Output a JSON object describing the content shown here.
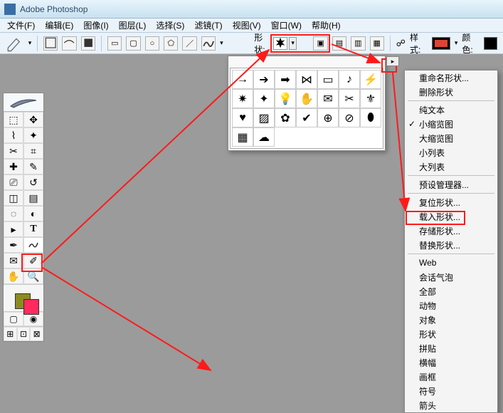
{
  "title": "Adobe Photoshop",
  "menu": [
    "文件(F)",
    "编辑(E)",
    "图像(I)",
    "图层(L)",
    "选择(S)",
    "滤镜(T)",
    "视图(V)",
    "窗口(W)",
    "帮助(H)"
  ],
  "options": {
    "shape_label": "形状:",
    "style_label": "样式:",
    "color_label": "颜色:"
  },
  "context_menu": {
    "rename": "重命名形状...",
    "delete": "删除形状",
    "text_only": "纯文本",
    "small_thumb": "小缩览图",
    "large_thumb": "大缩览图",
    "small_list": "小列表",
    "large_list": "大列表",
    "preset_mgr": "预设管理器...",
    "reset": "复位形状...",
    "load": "载入形状...",
    "save": "存储形状...",
    "replace": "替换形状...",
    "web": "Web",
    "bubble": "会话气泡",
    "all": "全部",
    "animal": "动物",
    "object": "对象",
    "shape": "形状",
    "puzzle": "拼贴",
    "banner": "横幅",
    "frame": "画框",
    "symbol": "符号",
    "arrow": "箭头"
  }
}
